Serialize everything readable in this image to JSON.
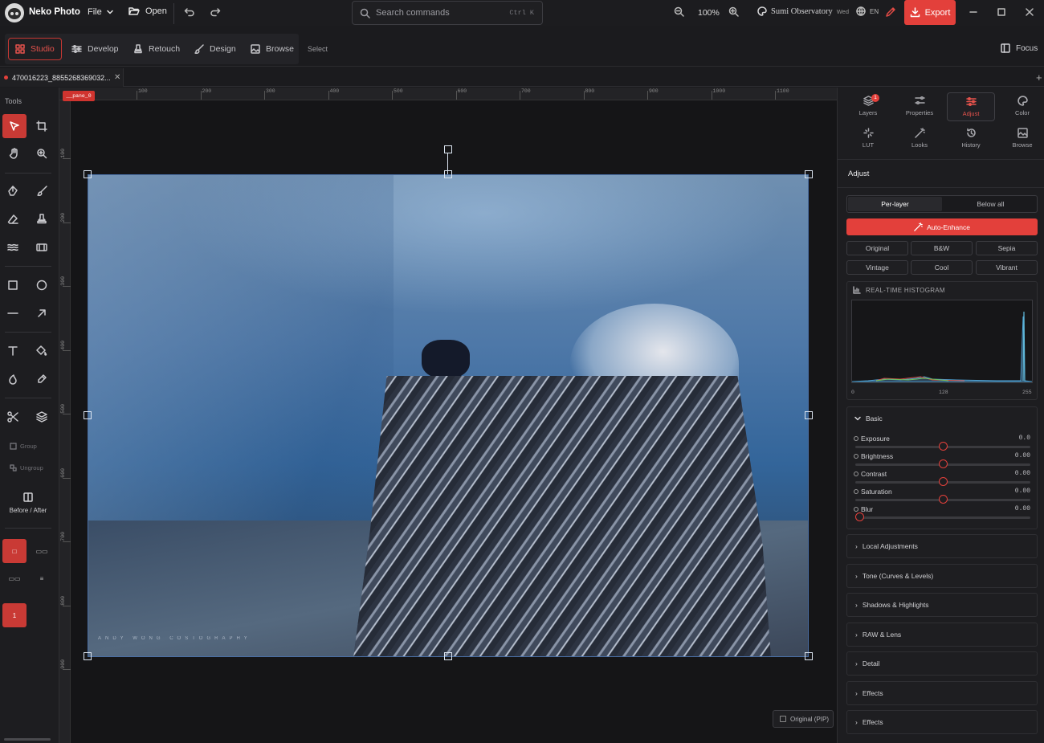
{
  "app": {
    "name": "Neko Photo"
  },
  "menu": {
    "file": "File",
    "open": "Open"
  },
  "search": {
    "placeholder": "Search commands",
    "shortcut": "Ctrl K"
  },
  "zoom": {
    "value": "100%"
  },
  "workspace": {
    "name": "Sumi Observatory",
    "weekday": "Wed",
    "lang": "EN"
  },
  "export": {
    "label": "Export"
  },
  "modes": [
    "Studio",
    "Develop",
    "Retouch",
    "Design",
    "Browse"
  ],
  "mode_select": "Select",
  "focus": "Focus",
  "document": {
    "tab": "470016223_8855268369032..."
  },
  "tools": {
    "label": "Tools",
    "group": "Group",
    "ungroup": "Ungroup",
    "before_after": "Before / After",
    "page_number": "1"
  },
  "pane_tag": "__pane_0",
  "ruler": {
    "top": [
      "100",
      "200",
      "300",
      "400",
      "500",
      "600",
      "700",
      "800",
      "900",
      "1000",
      "1100"
    ],
    "left": [
      "100",
      "200",
      "300",
      "400",
      "500",
      "600",
      "700",
      "800",
      "900"
    ]
  },
  "photo": {
    "watermark": "ANDY WONG COSTOGRAPHY"
  },
  "pip": {
    "label": "Original (PIP)"
  },
  "panel": {
    "tabs": [
      {
        "label": "Layers",
        "icon": "layers-icon",
        "badge": "1"
      },
      {
        "label": "Properties",
        "icon": "properties-icon"
      },
      {
        "label": "Adjust",
        "icon": "adjust-icon"
      },
      {
        "label": "Color",
        "icon": "palette-icon"
      },
      {
        "label": "LUT",
        "icon": "lut-icon"
      },
      {
        "label": "Looks",
        "icon": "wand-icon"
      },
      {
        "label": "History",
        "icon": "history-icon"
      },
      {
        "label": "Browse",
        "icon": "browse-icon"
      }
    ],
    "title": "Adjust",
    "scope": {
      "per_layer": "Per-layer",
      "below_all": "Below all"
    },
    "auto_enhance": "Auto-Enhance",
    "presets": [
      "Original",
      "B&W",
      "Sepia",
      "Vintage",
      "Cool",
      "Vibrant"
    ],
    "histogram": {
      "title": "REAL-TIME HISTOGRAM",
      "labels": [
        "0",
        "128",
        "255"
      ]
    },
    "basic": {
      "title": "Basic",
      "sliders": [
        {
          "label": "Exposure",
          "value": "0.0",
          "position": 0.5
        },
        {
          "label": "Brightness",
          "value": "0.00",
          "position": 0.5
        },
        {
          "label": "Contrast",
          "value": "0.00",
          "position": 0.5
        },
        {
          "label": "Saturation",
          "value": "0.00",
          "position": 0.5
        },
        {
          "label": "Blur",
          "value": "0.00",
          "position": 0.0
        }
      ]
    },
    "sections": [
      "Local Adjustments",
      "Tone (Curves & Levels)",
      "Shadows & Highlights",
      "RAW & Lens",
      "Detail",
      "Effects",
      "Effects"
    ]
  },
  "colors": {
    "accent": "#e3403b",
    "panel": "#1d1d20",
    "canvas": "#151517"
  }
}
